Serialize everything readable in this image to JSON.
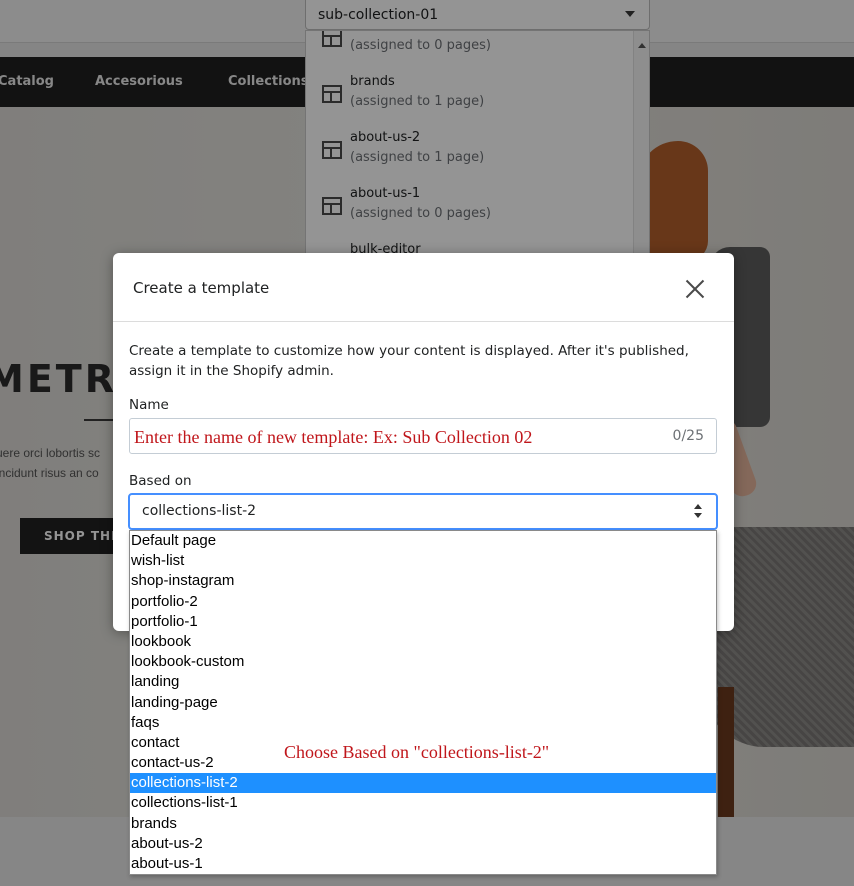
{
  "topbar": {
    "template_select_value": "sub-collection-01"
  },
  "store_nav": {
    "items": [
      "Catalog",
      "Accesorious",
      "Collections"
    ]
  },
  "hero": {
    "title": "METRO",
    "text_line1": "uere orci lobortis sc",
    "text_line2": "incidunt risus an co",
    "button_label": "SHOP THE"
  },
  "template_list": {
    "items": [
      {
        "name": "",
        "assigned": "(assigned to 0 pages)"
      },
      {
        "name": "brands",
        "assigned": "(assigned to 1 page)"
      },
      {
        "name": "about-us-2",
        "assigned": "(assigned to 1 page)"
      },
      {
        "name": "about-us-1",
        "assigned": "(assigned to 0 pages)"
      },
      {
        "name": "bulk-editor",
        "assigned": ""
      }
    ]
  },
  "modal": {
    "title": "Create a template",
    "description": "Create a template to customize how your content is displayed. After it's published, assign it in the Shopify admin.",
    "name_label": "Name",
    "name_placeholder": "Enter the name of new template: Ex: Sub Collection 02",
    "name_counter": "0/25",
    "based_on_label": "Based on",
    "based_on_value": "collections-list-2"
  },
  "based_on_options": {
    "items": [
      "Default page",
      "wish-list",
      "shop-instagram",
      "portfolio-2",
      "portfolio-1",
      "lookbook",
      "lookbook-custom",
      "landing",
      "landing-page",
      "faqs",
      "contact",
      "contact-us-2",
      "collections-list-2",
      "collections-list-1",
      "brands",
      "about-us-2",
      "about-us-1"
    ],
    "selected": "collections-list-2"
  },
  "annotation": {
    "text": "Choose Based on \"collections-list-2\""
  },
  "colors": {
    "accent_blue": "#458fff",
    "selected_option": "#1e90ff",
    "annotation_red": "#c0161b",
    "nav_dark": "#1f1f1f"
  },
  "icons": [
    "template-layout-icon",
    "close-icon",
    "chevron-down-icon",
    "select-arrows-icon",
    "scroll-up-icon"
  ]
}
